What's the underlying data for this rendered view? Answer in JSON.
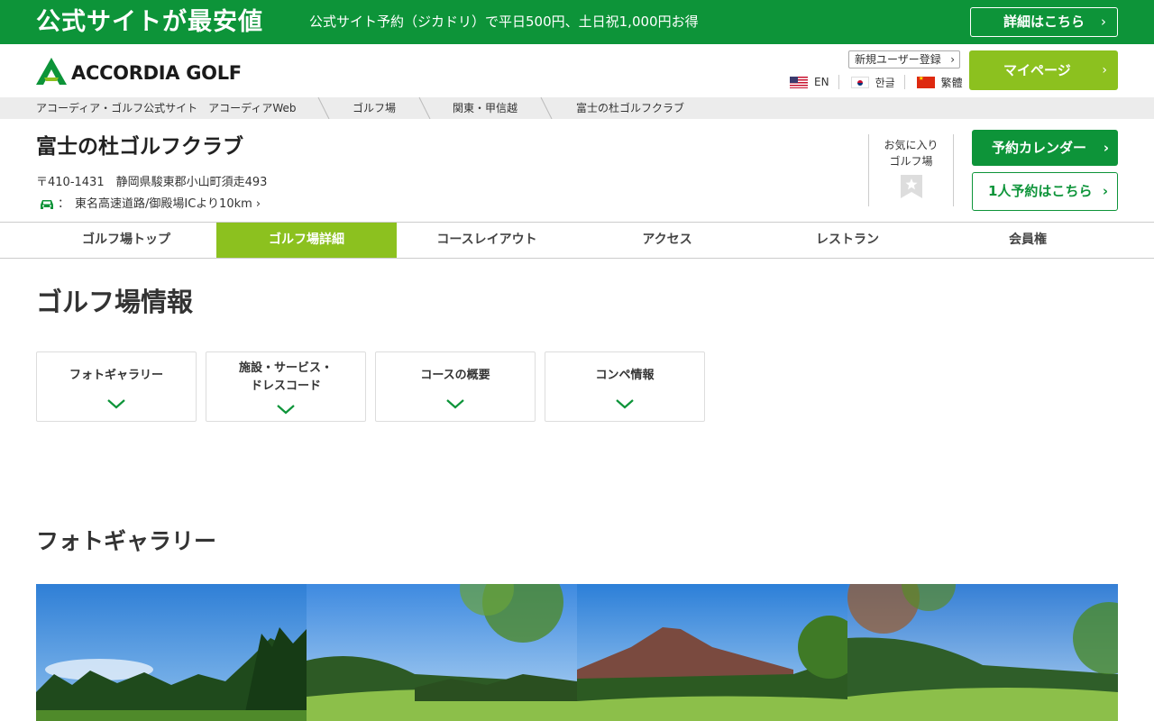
{
  "promo": {
    "title": "公式サイトが最安値",
    "text": "公式サイト予約（ジカドリ）で平日500円、土日祝1,000円お得",
    "button": "詳細はこちら",
    "chevron": "›"
  },
  "header": {
    "logo_text": "ACCORDIA GOLF",
    "register": "新規ユーザー登録",
    "mypage": "マイページ",
    "langs": [
      {
        "label": "EN",
        "flag": "flag-us"
      },
      {
        "label": "한글",
        "flag": "flag-kr"
      },
      {
        "label": "繁體",
        "flag": "flag-cn"
      }
    ]
  },
  "breadcrumb": [
    "アコーディア・ゴルフ公式サイト　アコーディアWeb",
    "ゴルフ場",
    "関東・甲信越",
    "富士の杜ゴルフクラブ"
  ],
  "club": {
    "name": "富士の杜ゴルフクラブ",
    "address": "〒410-1431　静岡県駿東郡小山町須走493",
    "access_prefix": "：",
    "access": "東名高速道路/御殿場ICより10km ›",
    "favorite": "お気に入り\nゴルフ場",
    "calendar_button": "予約カレンダー",
    "single_button": "1人予約はこちら"
  },
  "tabs": [
    {
      "label": "ゴルフ場トップ",
      "active": false
    },
    {
      "label": "ゴルフ場詳細",
      "active": true
    },
    {
      "label": "コースレイアウト",
      "active": false
    },
    {
      "label": "アクセス",
      "active": false
    },
    {
      "label": "レストラン",
      "active": false
    },
    {
      "label": "会員権",
      "active": false
    }
  ],
  "section": {
    "title": "ゴルフ場情報",
    "cards": [
      "フォトギャラリー",
      "施設・サービス・\nドレスコード",
      "コースの概要",
      "コンペ情報"
    ]
  },
  "gallery": {
    "title": "フォトギャラリー"
  },
  "colors": {
    "brand_green": "#0d9439",
    "accent_lime": "#8cc11f"
  },
  "icons": [
    "car-icon",
    "star-icon",
    "chevron-down-icon",
    "chevron-right-icon"
  ]
}
